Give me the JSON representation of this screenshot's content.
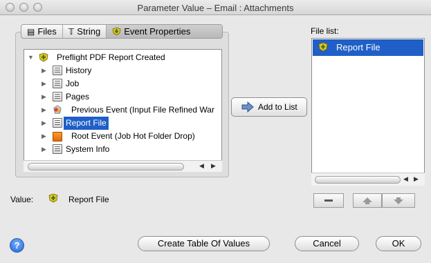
{
  "window": {
    "title": "Parameter Value – Email : Attachments"
  },
  "tabs": [
    {
      "label": "Files",
      "icon": "files-icon"
    },
    {
      "label": "String",
      "icon": "string-icon"
    },
    {
      "label": "Event Properties",
      "icon": "event-properties-icon",
      "active": true
    }
  ],
  "tree": {
    "root": "Preflight PDF Report Created",
    "items": [
      {
        "label": "History"
      },
      {
        "label": "Job"
      },
      {
        "label": "Pages"
      },
      {
        "label": "Previous Event (Input File Refined War"
      },
      {
        "label": "Report File",
        "selected": true
      },
      {
        "label": "Root Event (Job Hot Folder Drop)"
      },
      {
        "label": "System Info"
      }
    ]
  },
  "add_button": {
    "label": "Add to List"
  },
  "file_list": {
    "label": "File list:",
    "items": [
      {
        "label": "Report File",
        "selected": true
      }
    ]
  },
  "value": {
    "label": "Value:",
    "text": "Report File"
  },
  "help": {
    "glyph": "?"
  },
  "buttons": {
    "create_table": "Create Table Of Values",
    "cancel": "Cancel",
    "ok": "OK"
  },
  "colors": {
    "selection": "#1f5fc7",
    "help_blue": "#1f63d6"
  }
}
